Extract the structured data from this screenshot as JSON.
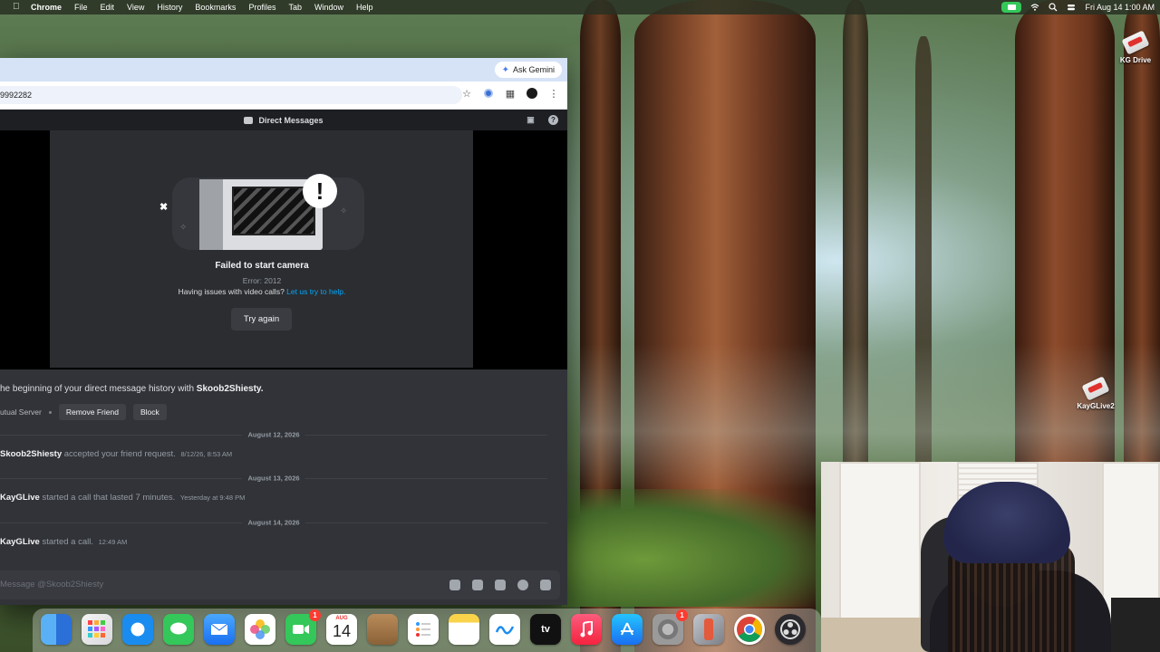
{
  "menubar": {
    "app": "Chrome",
    "items": [
      "File",
      "Edit",
      "View",
      "History",
      "Bookmarks",
      "Profiles",
      "Tab",
      "Window",
      "Help"
    ],
    "clock": "Fri Aug 14  1:00 AM"
  },
  "desktop": {
    "icons": [
      {
        "label": "KG Drive"
      },
      {
        "label": "KayGLive2"
      }
    ]
  },
  "browser": {
    "gemini_label": "Ask Gemini",
    "url": "9992282"
  },
  "discord": {
    "header_title": "Direct Messages",
    "call": {
      "title": "Failed to start camera",
      "error": "Error: 2012",
      "help_prefix": "Having issues with video calls?",
      "help_link": "Let us try to help.",
      "try_again": "Try again"
    },
    "intro_prefix": "he beginning of your direct message history with",
    "intro_user": "Skoob2Shiesty.",
    "mutual": "utual Server",
    "remove_friend": "Remove Friend",
    "block": "Block",
    "timeline": [
      {
        "date": "August 12, 2026",
        "user": "Skoob2Shiesty",
        "text": "accepted your friend request.",
        "time": "8/12/26, 8:53 AM"
      },
      {
        "date": "August 13, 2026",
        "user": "KayGLive",
        "text": "started a call that lasted 7 minutes.",
        "time": "Yesterday at 9:48 PM"
      },
      {
        "date": "August 14, 2026",
        "user": "KayGLive",
        "text": "started a call.",
        "time": "12:49 AM"
      }
    ],
    "composer_placeholder": "Message @Skoob2Shiesty"
  },
  "dock": {
    "facetime_badge": "1",
    "calendar_month": "AUG",
    "calendar_day": "14",
    "settings_badge": "1",
    "tv_label": "tv",
    "apps": [
      "finder-icon",
      "launchpad-icon",
      "safari-icon",
      "messages-icon",
      "mail-icon",
      "photos-icon",
      "facetime-icon",
      "calendar-icon",
      "contacts-icon",
      "reminders-icon",
      "notes-icon",
      "freeform-icon",
      "apple-tv-icon",
      "music-icon",
      "app-store-icon",
      "system-settings-icon",
      "iphone-mirroring-icon",
      "chrome-icon",
      "obs-icon"
    ]
  }
}
